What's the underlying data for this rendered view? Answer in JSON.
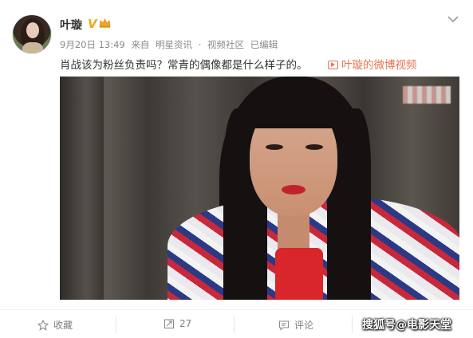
{
  "post": {
    "author": "叶璇",
    "verified_badge": "V",
    "date": "9月20日 13:49",
    "source_prefix": "来自",
    "source": "明星资讯",
    "dot": "·",
    "channel": "视频社区",
    "edited": "已编辑",
    "text": "肖战该为粉丝负责吗？常青的偶像都是什么样子的。",
    "video_link": "叶璇的微博视频"
  },
  "actions": {
    "favorite_label": "收藏",
    "repost_count": "27",
    "comment_label": "评论"
  },
  "watermark": {
    "brand": "搜狐号@电影天堂"
  },
  "colors": {
    "link": "#eb7350",
    "badge": "#f0a81c",
    "meta": "#8a8a8a"
  },
  "icons": {
    "more": "chevron-down-icon",
    "video": "video-icon",
    "favorite": "star-icon",
    "repost": "repost-icon",
    "comment": "comment-icon",
    "crown": "crown-icon"
  }
}
